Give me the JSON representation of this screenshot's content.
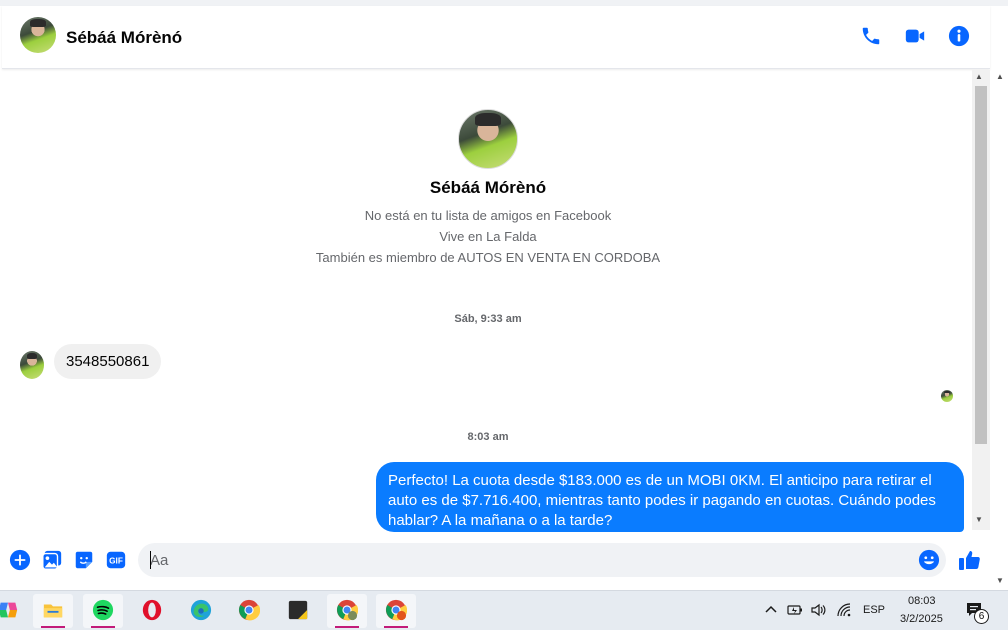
{
  "colors": {
    "accent": "#0a7cff",
    "header_icon": "#0866ff",
    "incoming_bubble": "#f0f0f0",
    "secondary_text": "#65676b",
    "taskbar_bg": "#e6ebf1",
    "taskbar_active_underline": "#c21b7a"
  },
  "header": {
    "contact_name": "Sébáá Mórènó",
    "icons": [
      "phone-icon",
      "video-camera-icon",
      "info-icon"
    ]
  },
  "profile": {
    "name": "Sébáá Mórènó",
    "lines": [
      "No está en tu lista de amigos en Facebook",
      "Vive en La Falda",
      "También es miembro de AUTOS EN VENTA EN CORDOBA"
    ]
  },
  "messages": [
    {
      "timestamp": "Sáb, 9:33 am"
    },
    {
      "direction": "incoming",
      "text": "3548550861"
    },
    {
      "timestamp": "8:03 am"
    },
    {
      "direction": "outgoing",
      "text": "Perfecto! La cuota desde $183.000 es de un MOBI 0KM. El anticipo para retirar el auto es de $7.716.400, mientras tanto podes ir pagando en cuotas. Cuándo podes hablar? A la mañana o a la tarde?"
    }
  ],
  "composer": {
    "placeholder": "Aa",
    "value": "",
    "icons": [
      "plus-icon",
      "image-icon",
      "sticker-icon",
      "gif-icon",
      "emoji-icon",
      "like-icon"
    ],
    "gif_label": "GIF"
  },
  "taskbar": {
    "apps": [
      "copilot-icon",
      "file-explorer-icon",
      "spotify-icon",
      "opera-icon",
      "edge-icon",
      "chrome-icon",
      "sticky-notes-icon",
      "chrome-profile-y-icon",
      "chrome-profile-r-icon"
    ],
    "tray": {
      "language": "ESP",
      "time": "08:03",
      "date": "3/2/2025",
      "notification_count": "6"
    }
  }
}
